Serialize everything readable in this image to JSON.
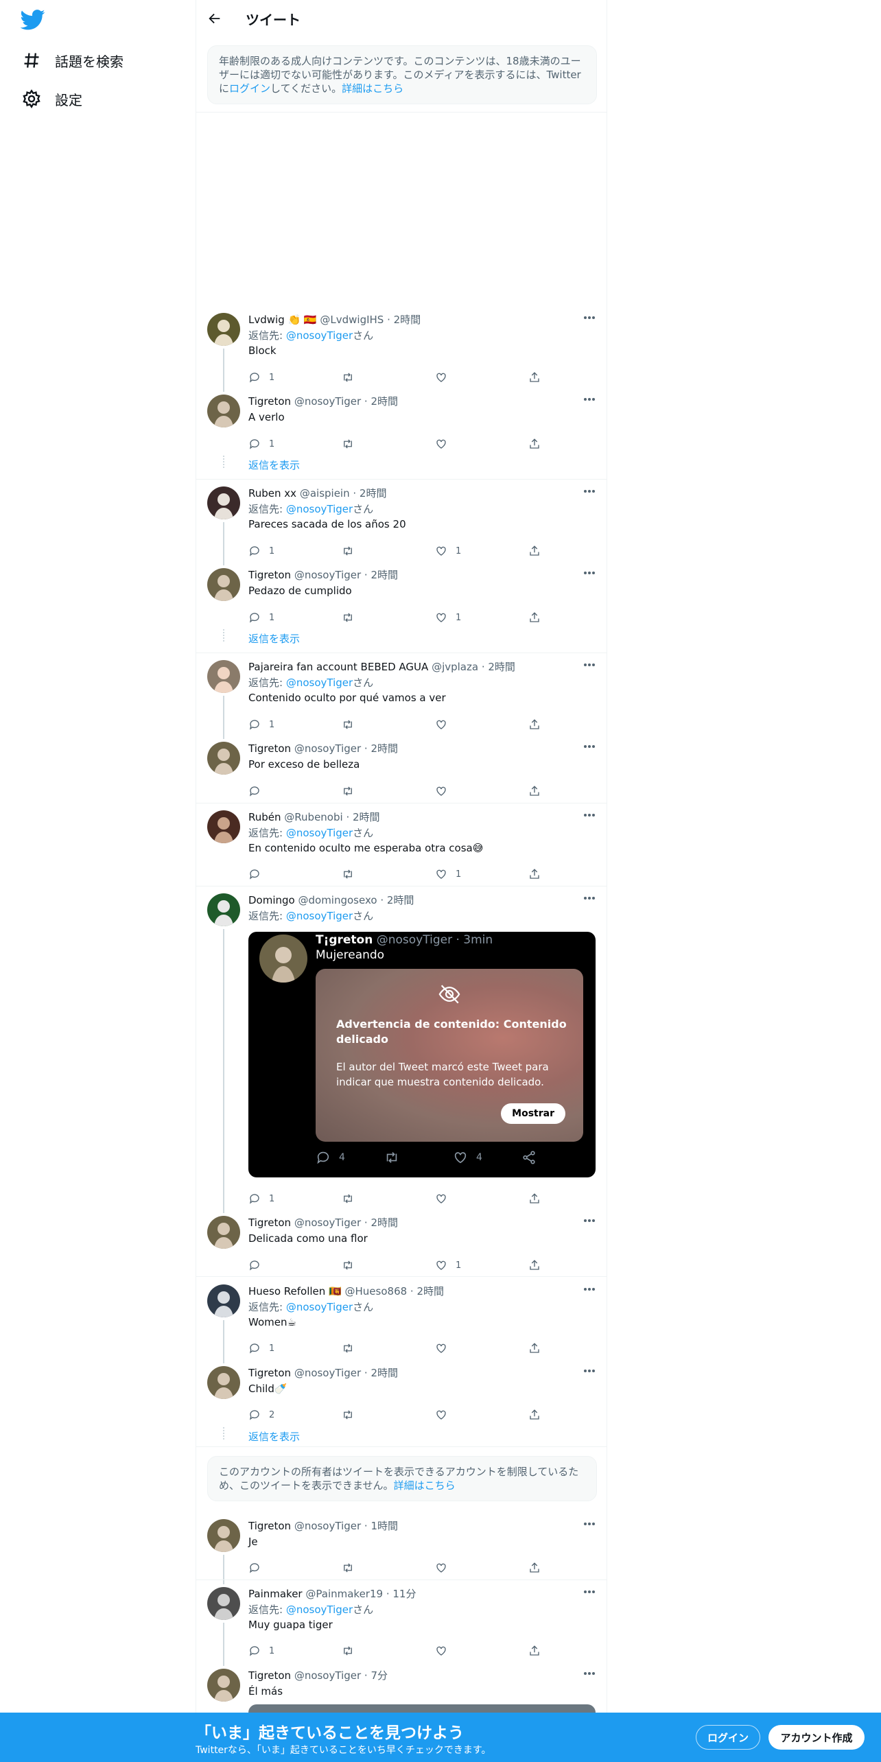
{
  "sidebar": {
    "items": [
      {
        "label": "話題を検索",
        "icon": "hashtag-icon"
      },
      {
        "label": "設定",
        "icon": "gear-icon"
      }
    ]
  },
  "header": {
    "title": "ツイート"
  },
  "notices": {
    "age": {
      "text": "年齢制限のある成人向けコンテンツです。このコンテンツは、18歳未満のユーザーには適切でない可能性があります。このメディアを表示するには、Twitter",
      "text2_pre": "に",
      "login": "ログイン",
      "text2_post": "してください。",
      "more": "詳細はこちら"
    },
    "restricted": {
      "text": "このアカウントの所有者はツイートを表示できるアカウントを制限しているため、このツイートを表示できません。",
      "more": "詳細はこちら"
    }
  },
  "show_replies": "返信を表示",
  "reply_prefix": "返信先: ",
  "reply_handle": "@nosoyTiger",
  "reply_suffix": "さん",
  "tweets": [
    {
      "name": "Lvdwig 👏 🇪🇸",
      "meta": "@LvdwigIHS · 2時間",
      "reply": true,
      "text": "Block",
      "replies": "1",
      "retweets": "",
      "likes": ""
    },
    {
      "name": "Tigreton",
      "meta": "@nosoyTiger · 2時間",
      "reply": false,
      "text": "A verlo",
      "replies": "1",
      "retweets": "",
      "likes": ""
    },
    {
      "name": "Ruben xx",
      "meta": "@aispiein · 2時間",
      "reply": true,
      "text": "Pareces sacada de los años 20",
      "replies": "1",
      "retweets": "",
      "likes": "1"
    },
    {
      "name": "Tigreton",
      "meta": "@nosoyTiger · 2時間",
      "reply": false,
      "text": "Pedazo de cumplido",
      "replies": "1",
      "retweets": "",
      "likes": "1"
    },
    {
      "name": "Pajareira fan account BEBED AGUA",
      "meta": "@jvplaza · 2時間",
      "reply": true,
      "text": "Contenido oculto por qué vamos a ver",
      "replies": "1",
      "retweets": "",
      "likes": ""
    },
    {
      "name": "Tigreton",
      "meta": "@nosoyTiger · 2時間",
      "reply": false,
      "text": "Por exceso de belleza",
      "replies": "",
      "retweets": "",
      "likes": ""
    },
    {
      "name": "Rubén",
      "meta": "@Rubenobi · 2時間",
      "reply": true,
      "text": "En contenido oculto me esperaba otra cosa😅",
      "replies": "",
      "retweets": "",
      "likes": "1"
    },
    {
      "name": "Domingo",
      "meta": "@domingosexo · 2時間",
      "reply": true,
      "text": "",
      "replies": "1",
      "retweets": "",
      "likes": ""
    },
    {
      "name": "Tigreton",
      "meta": "@nosoyTiger · 2時間",
      "reply": false,
      "text": "Delicada como una flor",
      "replies": "",
      "retweets": "",
      "likes": "1"
    },
    {
      "name": "Hueso Refollen 🇱🇰",
      "meta": "@Hueso868 · 2時間",
      "reply": true,
      "text": "Women☕",
      "replies": "1",
      "retweets": "",
      "likes": ""
    },
    {
      "name": "Tigreton",
      "meta": "@nosoyTiger · 2時間",
      "reply": false,
      "text": "Child🍼",
      "replies": "2",
      "retweets": "",
      "likes": ""
    },
    {
      "name": "Tigreton",
      "meta": "@nosoyTiger · 1時間",
      "reply": false,
      "text": "Je",
      "replies": "",
      "retweets": "",
      "likes": ""
    },
    {
      "name": "Painmaker",
      "meta": "@Painmaker19 · 11分",
      "reply": true,
      "text": "Muy guapa tiger",
      "replies": "1",
      "retweets": "",
      "likes": ""
    },
    {
      "name": "Tigreton",
      "meta": "@nosoyTiger · 7分",
      "reply": false,
      "text": "Él más",
      "replies": "",
      "retweets": "",
      "likes": ""
    }
  ],
  "quote": {
    "name": "T¡greton",
    "meta": "@nosoyTiger · 3min",
    "text": "Mujereando",
    "warn_title": "Advertencia de contenido: Contenido delicado",
    "warn_body": "El autor del Tweet marcó este Tweet para indicar que muestra contenido delicado.",
    "show": "Mostrar",
    "replies": "4",
    "likes": "4"
  },
  "bottom_bar": {
    "title": "「いま」起きていることを見つけよう",
    "subtitle": "Twitterなら、「いま」起きていることをいち早くチェックできます。",
    "login": "ログイン",
    "signup": "アカウント作成"
  },
  "colors": {
    "accent": "#1d9bf0",
    "text": "#0f1419",
    "muted": "#536471"
  }
}
